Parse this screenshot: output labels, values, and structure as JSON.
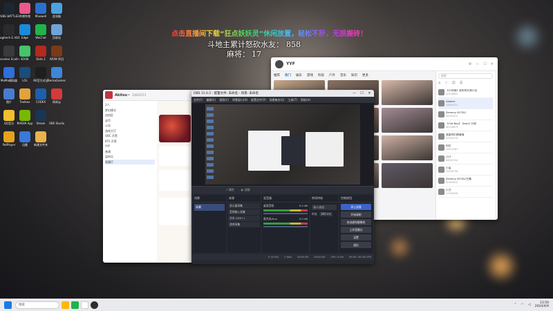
{
  "overlay": {
    "banner": "点击直播间下载“狂点妖妖灵”休闲放置，轻松不肝，无损搬砖！",
    "line2_label": "斗地主累计怒砍水友：",
    "line2_value": "858",
    "line3_label": "麻将：",
    "line3_value": "17"
  },
  "desktop_icons": [
    {
      "label": "PUBG BATTLEGROUNDS",
      "color": "#1c2733"
    },
    {
      "label": "哔哩哔哩",
      "color": "#e85a8a"
    },
    {
      "label": "Maxwell",
      "color": "#2a6fd0"
    },
    {
      "label": "此电脑",
      "color": "#4aa3e0"
    },
    {
      "label": "Logitech G HUB",
      "color": "#2b2b2b"
    },
    {
      "label": "Edge",
      "color": "#1a8bd8"
    },
    {
      "label": "WeChat",
      "color": "#1fb34a"
    },
    {
      "label": "回收站",
      "color": "#6fa4d8"
    },
    {
      "label": "Lossless Scaling",
      "color": "#3a3a3a"
    },
    {
      "label": "KOOK",
      "color": "#46c36b"
    },
    {
      "label": "Dota 2",
      "color": "#b22a1d"
    },
    {
      "label": "WOW 怀旧",
      "color": "#7a3a1a"
    },
    {
      "label": "MuMu模拟器",
      "color": "#2d6fdb"
    },
    {
      "label": "LOL",
      "color": "#1b4d7a"
    },
    {
      "label": "KK官方对战",
      "color": "#1e1e1e"
    },
    {
      "label": "BeckoGames",
      "color": "#3d86d9"
    },
    {
      "label": "图片",
      "color": "#4a7bd2"
    },
    {
      "label": "Toolbox",
      "color": "#e2a33d"
    },
    {
      "label": "CODEX",
      "color": "#1d5fae"
    },
    {
      "label": "网易云",
      "color": "#d23b3b"
    },
    {
      "label": "QQ音乐",
      "color": "#f2c02d"
    },
    {
      "label": "NVIDIA App",
      "color": "#76b900"
    },
    {
      "label": "Steam",
      "color": "#1a3554"
    },
    {
      "label": "OBS Studio",
      "color": "#2d2d2d"
    },
    {
      "label": "PotPlayer",
      "color": "#e6a21e"
    },
    {
      "label": "迅雷",
      "color": "#3b79d8"
    },
    {
      "label": "新建文件夹",
      "color": "#e8b34a"
    }
  ],
  "yyf_window": {
    "name": "YYF",
    "tabs": [
      "推荐",
      "热门",
      "娱乐",
      "游戏",
      "科技",
      "户外",
      "音乐",
      "知识",
      "更多"
    ],
    "search_placeholder": "搜索",
    "list": [
      {
        "name": "【小阿德】金秋的开黑小队",
        "id": "12456803"
      },
      {
        "name": "Akaterr",
        "id": "32829721"
      },
      {
        "name": "Dreamy DOTA2",
        "id": "54263912"
      },
      {
        "name": "【Old Boy】 Dota2 开黑",
        "id": "45126873"
      },
      {
        "name": "我要你们搞事情",
        "id": "32904135"
      },
      {
        "name": "阿尼",
        "id": "14521087"
      },
      {
        "name": "123",
        "id": "84621554"
      },
      {
        "name": "小蓝",
        "id": "23146758"
      },
      {
        "name": "Dreamy DOTA2主播",
        "id": "62349812"
      },
      {
        "name": "小刀",
        "id": "17264508"
      }
    ]
  },
  "chat_window": {
    "title": "Akitsu~",
    "id": "32829721",
    "channels": [
      "2人",
      "梦幻模式",
      "自由区",
      "金币",
      "公告",
      "游戏大厅",
      "OBC 开黑",
      "KTV 开黑",
      "YYF",
      "普通",
      "监听位",
      "直播厅"
    ]
  },
  "obs": {
    "title": "OBS 31.0.2 - 配置文件: 未命名 - 场景: 未命名",
    "menu": [
      "文件(F)",
      "编辑(E)",
      "视图(V)",
      "停靠窗口(D)",
      "配置文件(P)",
      "场景集合(S)",
      "工具(T)",
      "帮助(H)"
    ],
    "panels": {
      "scenes": "场景",
      "sources": "来源",
      "mixer": "混音器",
      "transitions": "转场特效",
      "controls": "控制按钮"
    },
    "scene_item": "场景",
    "source_items": [
      "显示器采集",
      "音频输入采集",
      "文本 (GDI+)",
      "游戏采集"
    ],
    "mixer_items": [
      {
        "name": "桌面音频",
        "level": "0.0 dB"
      },
      {
        "name": "麦克风/Aux",
        "level": "0.0 dB"
      }
    ],
    "transition": "淡入淡出",
    "duration_label": "时长",
    "duration": "300 ms",
    "controls": [
      "停止直播",
      "开始录制",
      "启动虚拟摄像机",
      "工作室模式",
      "设置",
      "退出"
    ],
    "status": {
      "frames": "0 (0.0%)",
      "bitrate": "0 kb/s",
      "time1": "00:00:00",
      "time2": "00:00:00",
      "cpu": "CPU: 0.4%",
      "fps": "60.00 / 60.00 FPS"
    }
  },
  "taskbar": {
    "search": "搜索",
    "time": "13:50",
    "date": "2024/4/9"
  }
}
